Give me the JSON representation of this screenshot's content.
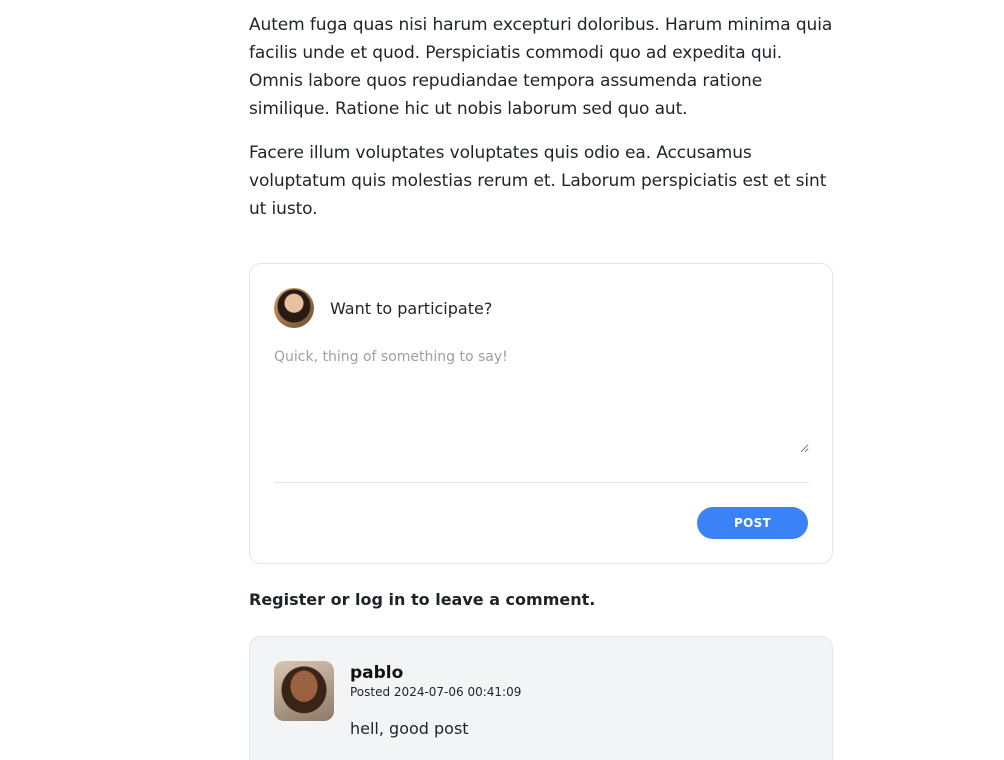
{
  "article": {
    "paragraphs": [
      "Autem fuga quas nisi harum excepturi doloribus. Harum minima quia facilis unde et quod. Perspiciatis commodi quo ad expedita qui. Omnis labore quos repudiandae tempora assumenda ratione similique. Ratione hic ut nobis laborum sed quo aut.",
      "Facere illum voluptates voluptates quis odio ea. Accusamus voluptatum quis molestias rerum et. Laborum perspiciatis est et sint ut iusto."
    ]
  },
  "compose": {
    "title": "Want to participate?",
    "placeholder": "Quick, thing of something to say!",
    "post_label": "POST"
  },
  "auth_note": "Register or log in to leave a comment.",
  "comments": [
    {
      "author": "pablo",
      "meta": "Posted 2024-07-06 00:41:09",
      "body": "hell, good post"
    }
  ],
  "colors": {
    "accent": "#3b82f6",
    "comment_bg": "#f3f4f6",
    "border": "#e3e5e8"
  }
}
